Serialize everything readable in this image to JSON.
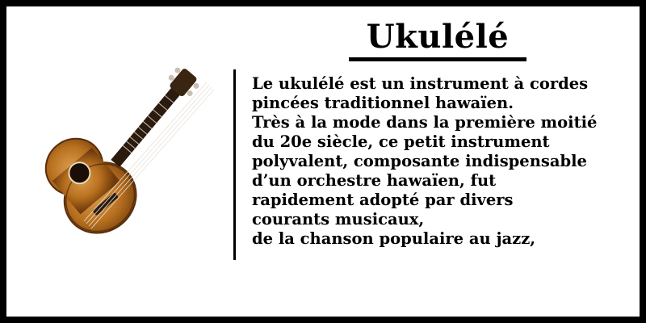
{
  "title": "Ukulélé",
  "description_lines": [
    "Le ukulélé est un instrument à cordes",
    "pincées traditionnel hawaïen.",
    "Très à la mode dans la première moitié",
    "du 20e siècle, ce petit instrument",
    "polyvalent, composante indispensable",
    "d’un orchestre hawaïen, fut",
    "rapidement adopté par divers",
    "courants musicaux,",
    "de la chanson populaire au jazz,"
  ],
  "image": {
    "icon": "ukulele-icon",
    "colors": {
      "body": "#b8701f",
      "body_dark": "#6e3a0c",
      "fretboard": "#2b1a0e",
      "headstock": "#3a2412"
    }
  }
}
